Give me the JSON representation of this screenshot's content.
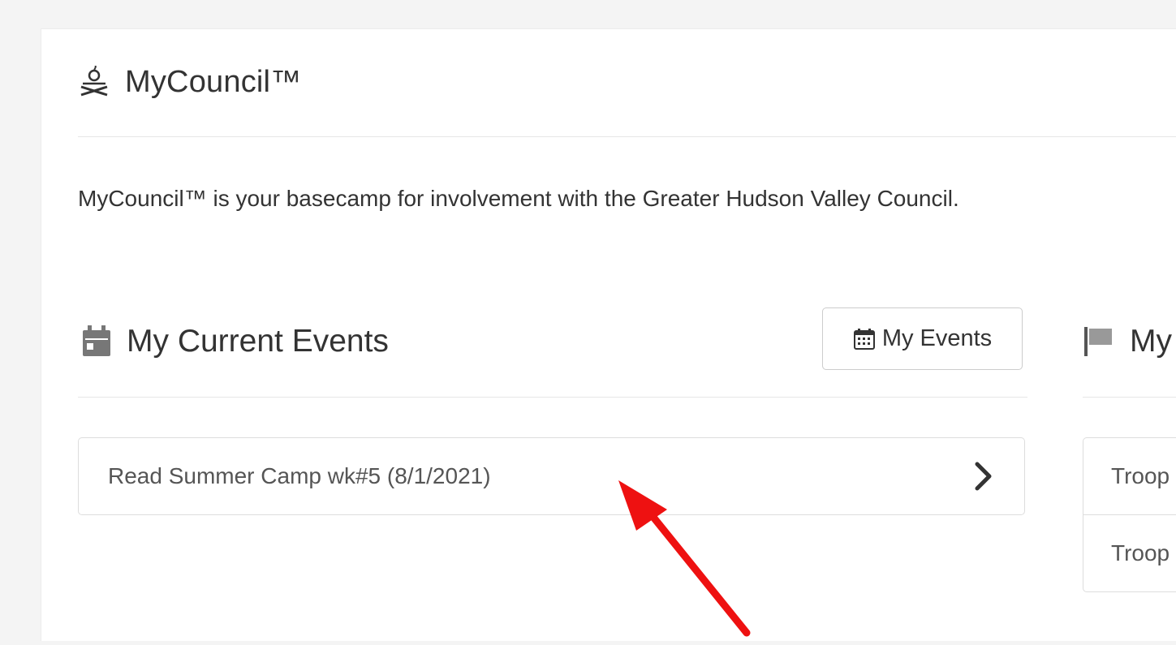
{
  "header": {
    "logo_icon": "campfire-icon",
    "title": "MyCouncil™"
  },
  "intro": {
    "text": "MyCouncil™ is your basecamp for involvement with the Greater Hudson Valley Council."
  },
  "current_events": {
    "icon": "calendar-icon",
    "title": "My Current Events",
    "my_events_button": {
      "icon": "calendar-grid-icon",
      "label": "My Events"
    },
    "items": [
      {
        "label": "Read Summer Camp wk#5 (8/1/2021)",
        "icon": "chevron-right-icon"
      }
    ]
  },
  "groups": {
    "icon": "flag-icon",
    "title": "My",
    "items": [
      {
        "label": "Troop"
      },
      {
        "label": "Troop"
      }
    ]
  },
  "annotation": {
    "icon": "red-arrow-icon",
    "color": "#ee1111"
  }
}
